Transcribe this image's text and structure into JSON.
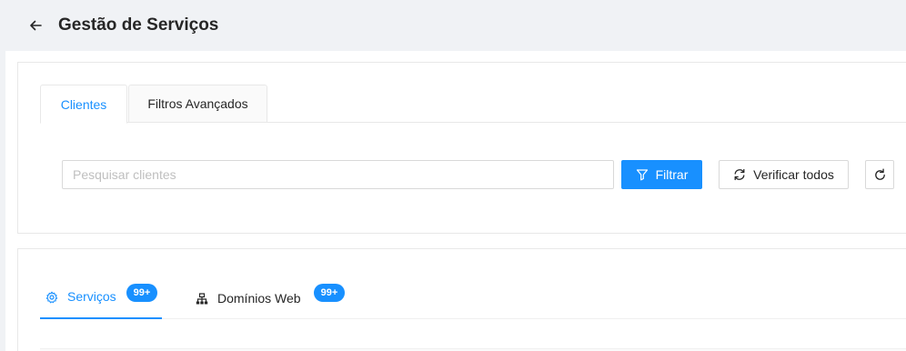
{
  "header": {
    "back_icon": "arrow-left-icon",
    "title": "Gestão de Serviços"
  },
  "filter_card": {
    "tabs": [
      {
        "label": "Clientes",
        "active": true
      },
      {
        "label": "Filtros Avançados",
        "active": false
      }
    ],
    "search": {
      "value": "",
      "placeholder": "Pesquisar clientes"
    },
    "filter_button": {
      "label": "Filtrar",
      "icon": "filter-icon"
    },
    "verify_button": {
      "label": "Verificar todos",
      "icon": "sync-icon"
    },
    "refresh_button": {
      "icon": "reload-icon"
    }
  },
  "service_tabs": [
    {
      "label": "Serviços",
      "icon": "gear-icon",
      "badge": "99+",
      "active": true
    },
    {
      "label": "Domínios Web",
      "icon": "sitemap-icon",
      "badge": "99+",
      "active": false
    }
  ],
  "colors": {
    "accent": "#1890ff",
    "background": "#f0f2f5",
    "border": "#d9d9d9"
  }
}
